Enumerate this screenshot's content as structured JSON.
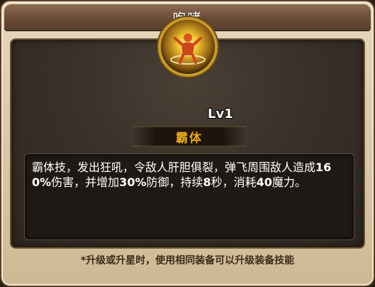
{
  "dialog": {
    "title": "咆哮"
  },
  "skill": {
    "icon": "roaring-figure-icon",
    "level": "Lv1",
    "name": "霸体",
    "description": "霸体技，发出狂吼，令敌人肝胆俱裂，弹飞周围敌人造成160%伤害，并增加30%防御，持续8秒，消耗40魔力。"
  },
  "footer": {
    "note": "*升级或升星时，使用相同装备可以升级装备技能"
  },
  "colors": {
    "skill_name": "#e8a524",
    "title_bar": "#6a4b37",
    "panel_bg": "#e6d8bc"
  }
}
